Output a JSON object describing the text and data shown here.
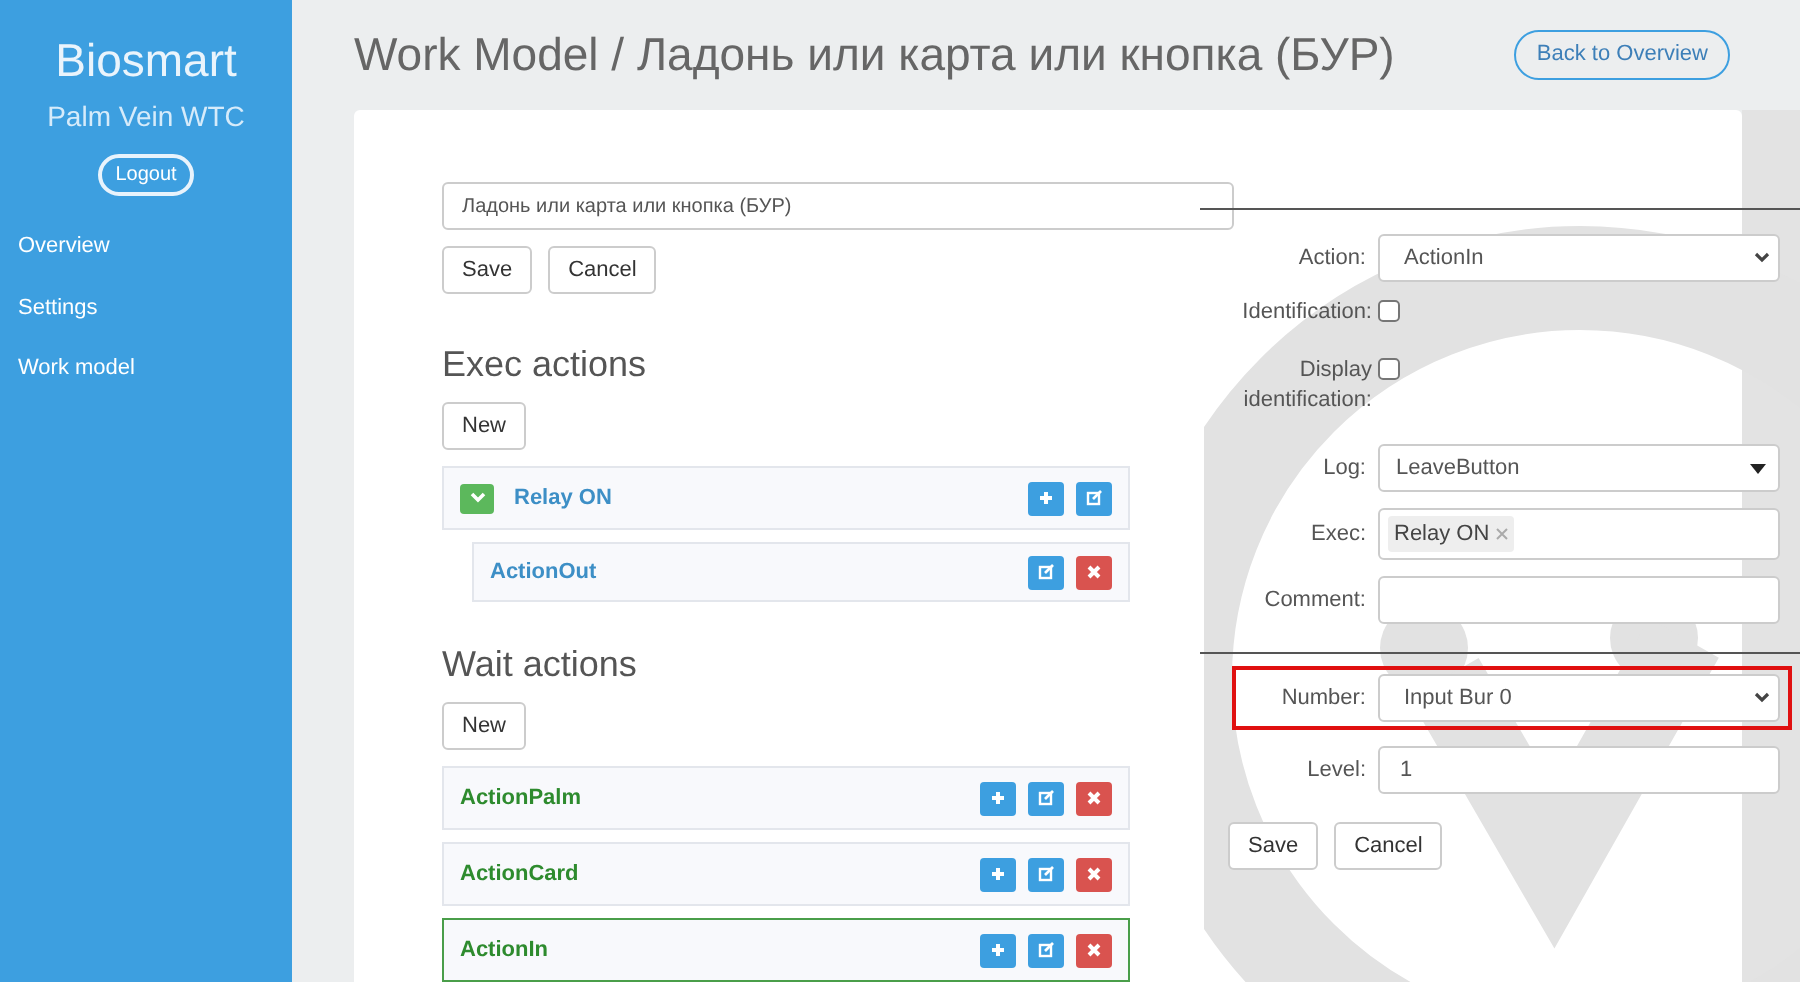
{
  "sidebar": {
    "brand": "Biosmart",
    "subtitle": "Palm Vein WTC",
    "logout": "Logout",
    "items": [
      {
        "label": "Overview"
      },
      {
        "label": "Settings"
      },
      {
        "label": "Work model"
      }
    ]
  },
  "header": {
    "title": "Work Model / Ладонь или карта или кнопка (БУР)",
    "back_button": "Back to Overview"
  },
  "name_field": {
    "value": "Ладонь или карта или кнопка (БУР)"
  },
  "name_buttons": [
    "Save",
    "Cancel"
  ],
  "sections": [
    {
      "kind": "exec",
      "title": "Exec actions",
      "new_button": "New",
      "items": [
        {
          "label": "Relay ON",
          "expanded": true,
          "selected": false,
          "actions": [
            {
              "kind": "add"
            },
            {
              "kind": "edit"
            }
          ],
          "children": [
            {
              "label": "ActionOut",
              "actions": [
                {
                  "kind": "edit"
                },
                {
                  "kind": "delete"
                }
              ]
            }
          ]
        }
      ]
    },
    {
      "kind": "wait",
      "title": "Wait actions",
      "new_button": "New",
      "items": [
        {
          "label": "ActionPalm",
          "selected": false,
          "actions": [
            {
              "kind": "add"
            },
            {
              "kind": "edit"
            },
            {
              "kind": "delete"
            }
          ]
        },
        {
          "label": "ActionCard",
          "selected": false,
          "actions": [
            {
              "kind": "add"
            },
            {
              "kind": "edit"
            },
            {
              "kind": "delete"
            }
          ]
        },
        {
          "label": "ActionIn",
          "selected": true,
          "actions": [
            {
              "kind": "add"
            },
            {
              "kind": "edit"
            },
            {
              "kind": "delete"
            }
          ]
        }
      ]
    }
  ],
  "form": {
    "fields": [
      {
        "kind": "select",
        "label": "Action:",
        "value": "ActionIn"
      },
      {
        "kind": "checkbox",
        "label": "Identification:",
        "checked": false
      },
      {
        "kind": "checkbox",
        "label": "Display identification:",
        "checked": false
      },
      {
        "kind": "dropdown",
        "label": "Log:",
        "value": "LeaveButton"
      },
      {
        "kind": "tags",
        "label": "Exec:",
        "tags": [
          "Relay ON"
        ]
      },
      {
        "kind": "text",
        "label": "Comment:"
      },
      {
        "kind": "divider"
      },
      {
        "kind": "select",
        "label": "Number:",
        "value": "Input Bur 0",
        "highlighted": true
      },
      {
        "kind": "text",
        "label": "Level:",
        "value": "1"
      }
    ],
    "buttons": [
      "Save",
      "Cancel"
    ]
  }
}
